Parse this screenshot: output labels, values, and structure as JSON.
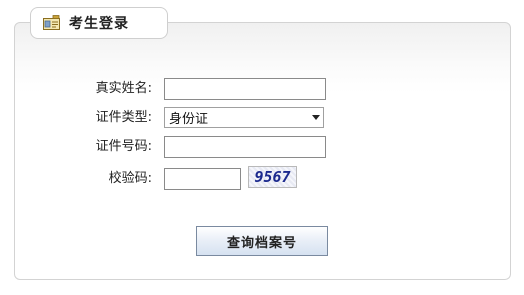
{
  "panel": {
    "title": "考生登录",
    "icon": "id-card-icon"
  },
  "form": {
    "name_label": "真实姓名:",
    "name_value": "",
    "id_type_label": "证件类型:",
    "id_type_selected": "身份证",
    "id_number_label": "证件号码:",
    "id_number_value": "",
    "captcha_label": "校验码:",
    "captcha_value": "",
    "captcha_text": "9567",
    "submit_label": "查询档案号"
  },
  "colors": {
    "captcha_text": "#1c2a8e",
    "button_gradient_end": "#d6e2f1"
  }
}
